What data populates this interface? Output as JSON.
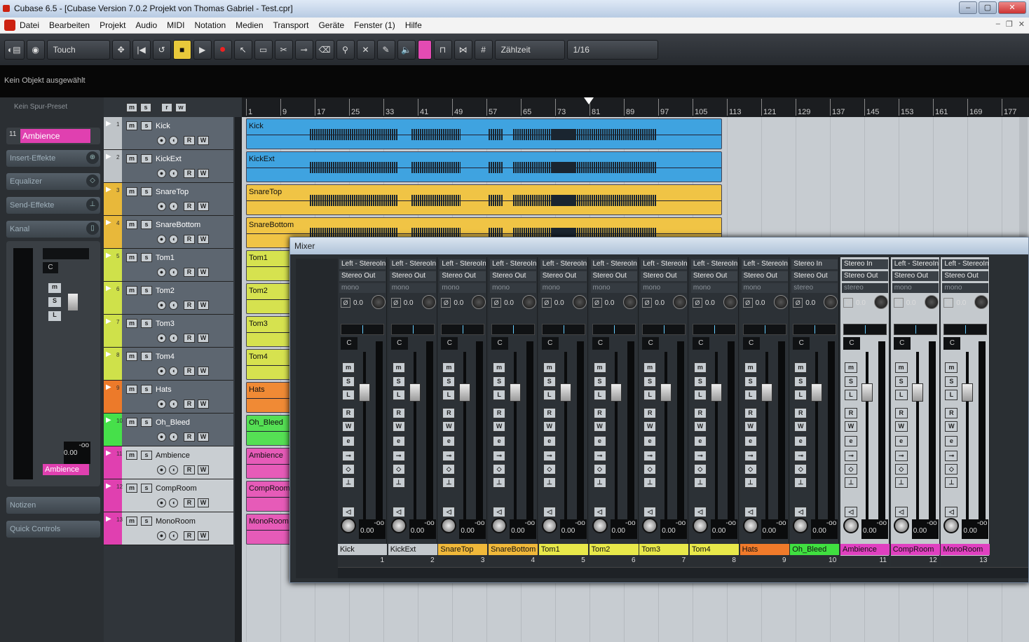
{
  "window": {
    "title": "Cubase 6.5 - [Cubase Version 7.0.2 Projekt von Thomas Gabriel - Test.cpr]"
  },
  "menu": [
    "Datei",
    "Bearbeiten",
    "Projekt",
    "Audio",
    "MIDI",
    "Notation",
    "Medien",
    "Transport",
    "Geräte",
    "Fenster (1)",
    "Hilfe"
  ],
  "toolbar": {
    "automation_mode": "Touch",
    "grid_type": "Zählzeit",
    "quantize": "1/16"
  },
  "info_line": "Kein Objekt ausgewählt",
  "inspector": {
    "preset": "Kein Spur-Preset",
    "track_number": "11",
    "track_name": "Ambience",
    "sections": [
      "Insert-Effekte",
      "Equalizer",
      "Send-Effekte",
      "Kanal"
    ],
    "fader_value": "0.00",
    "meter_peak": "-oo",
    "channel_label": "Ambience",
    "bottom_sections": [
      "Notizen",
      "Quick Controls"
    ]
  },
  "tracks": [
    {
      "n": "1",
      "name": "Kick",
      "color": "#bfc4c8",
      "sel": false
    },
    {
      "n": "2",
      "name": "KickExt",
      "color": "#bfc4c8",
      "sel": false
    },
    {
      "n": "3",
      "name": "SnareTop",
      "color": "#e8b83a",
      "sel": false
    },
    {
      "n": "4",
      "name": "SnareBottom",
      "color": "#e8b83a",
      "sel": false
    },
    {
      "n": "5",
      "name": "Tom1",
      "color": "#cfe14a",
      "sel": false
    },
    {
      "n": "6",
      "name": "Tom2",
      "color": "#cfe14a",
      "sel": false
    },
    {
      "n": "7",
      "name": "Tom3",
      "color": "#cfe14a",
      "sel": false
    },
    {
      "n": "8",
      "name": "Tom4",
      "color": "#cfe14a",
      "sel": false
    },
    {
      "n": "9",
      "name": "Hats",
      "color": "#ec7a2a",
      "sel": false
    },
    {
      "n": "10",
      "name": "Oh_Bleed",
      "color": "#46e04a",
      "sel": false
    },
    {
      "n": "11",
      "name": "Ambience",
      "color": "#e040b0",
      "sel": true
    },
    {
      "n": "12",
      "name": "CompRoom",
      "color": "#e040b0",
      "sel": true
    },
    {
      "n": "13",
      "name": "MonoRoom",
      "color": "#e040b0",
      "sel": true
    }
  ],
  "ruler": [
    "1",
    "9",
    "17",
    "25",
    "33",
    "41",
    "49",
    "57",
    "65",
    "73",
    "81",
    "89",
    "97",
    "105",
    "113",
    "121",
    "129",
    "137",
    "145",
    "153",
    "161",
    "169",
    "177"
  ],
  "events": [
    {
      "name": "Kick",
      "color": "#3fa3e0"
    },
    {
      "name": "KickExt",
      "color": "#3fa3e0"
    },
    {
      "name": "SnareTop",
      "color": "#f0c445"
    },
    {
      "name": "SnareBottom",
      "color": "#f0c445"
    },
    {
      "name": "Tom1",
      "color": "#d6e24f"
    },
    {
      "name": "Tom2",
      "color": "#d6e24f"
    },
    {
      "name": "Tom3",
      "color": "#d6e24f"
    },
    {
      "name": "Tom4",
      "color": "#d6e24f"
    },
    {
      "name": "Hats",
      "color": "#f08a35"
    },
    {
      "name": "Oh_Bleed",
      "color": "#55e054"
    },
    {
      "name": "Ambience",
      "color": "#e65bb8"
    },
    {
      "name": "CompRoom",
      "color": "#e65bb8"
    },
    {
      "name": "MonoRoom",
      "color": "#e65bb8"
    }
  ],
  "mixer": {
    "title": "Mixer",
    "channels": [
      {
        "in": "Left - StereoIn",
        "out": "Stereo Out",
        "mode": "mono",
        "gain": "0.0",
        "vol": "0.00",
        "peak": "-oo",
        "name": "Kick",
        "color": "#c4c9cd",
        "idx": "1",
        "light": false
      },
      {
        "in": "Left - StereoIn",
        "out": "Stereo Out",
        "mode": "mono",
        "gain": "0.0",
        "vol": "0.00",
        "peak": "-oo",
        "name": "KickExt",
        "color": "#c4c9cd",
        "idx": "2",
        "light": false
      },
      {
        "in": "Left - StereoIn",
        "out": "Stereo Out",
        "mode": "mono",
        "gain": "0.0",
        "vol": "0.00",
        "peak": "-oo",
        "name": "SnareTop",
        "color": "#f0b83a",
        "idx": "3",
        "light": false
      },
      {
        "in": "Left - StereoIn",
        "out": "Stereo Out",
        "mode": "mono",
        "gain": "0.0",
        "vol": "0.00",
        "peak": "-oo",
        "name": "SnareBottom",
        "color": "#f0b83a",
        "idx": "4",
        "light": false
      },
      {
        "in": "Left - StereoIn",
        "out": "Stereo Out",
        "mode": "mono",
        "gain": "0.0",
        "vol": "0.00",
        "peak": "-oo",
        "name": "Tom1",
        "color": "#e8e84a",
        "idx": "5",
        "light": false
      },
      {
        "in": "Left - StereoIn",
        "out": "Stereo Out",
        "mode": "mono",
        "gain": "0.0",
        "vol": "0.00",
        "peak": "-oo",
        "name": "Tom2",
        "color": "#e8e84a",
        "idx": "6",
        "light": false
      },
      {
        "in": "Left - StereoIn",
        "out": "Stereo Out",
        "mode": "mono",
        "gain": "0.0",
        "vol": "0.00",
        "peak": "-oo",
        "name": "Tom3",
        "color": "#e8e84a",
        "idx": "7",
        "light": false
      },
      {
        "in": "Left - StereoIn",
        "out": "Stereo Out",
        "mode": "mono",
        "gain": "0.0",
        "vol": "0.00",
        "peak": "-oo",
        "name": "Tom4",
        "color": "#e8e84a",
        "idx": "8",
        "light": false
      },
      {
        "in": "Left - StereoIn",
        "out": "Stereo Out",
        "mode": "mono",
        "gain": "0.0",
        "vol": "0.00",
        "peak": "-oo",
        "name": "Hats",
        "color": "#f07a2a",
        "idx": "9",
        "light": false
      },
      {
        "in": "Stereo In",
        "out": "Stereo Out",
        "mode": "stereo",
        "gain": "0.0",
        "vol": "0.00",
        "peak": "-oo",
        "name": "Oh_Bleed",
        "color": "#40e040",
        "idx": "10",
        "light": false
      },
      {
        "in": "Stereo In",
        "out": "Stereo Out",
        "mode": "stereo",
        "gain": "0.0",
        "vol": "0.00",
        "peak": "-oo",
        "name": "Ambience",
        "color": "#e040c0",
        "idx": "11",
        "light": true
      },
      {
        "in": "Left - StereoIn",
        "out": "Stereo Out",
        "mode": "mono",
        "gain": "0.0",
        "vol": "0.00",
        "peak": "-oo",
        "name": "CompRoom",
        "color": "#e040c0",
        "idx": "12",
        "light": true
      },
      {
        "in": "Left - StereoIn",
        "out": "Stereo Out",
        "mode": "mono",
        "gain": "0.0",
        "vol": "0.00",
        "peak": "-oo",
        "name": "MonoRoom",
        "color": "#e040c0",
        "idx": "13",
        "light": true
      }
    ]
  }
}
